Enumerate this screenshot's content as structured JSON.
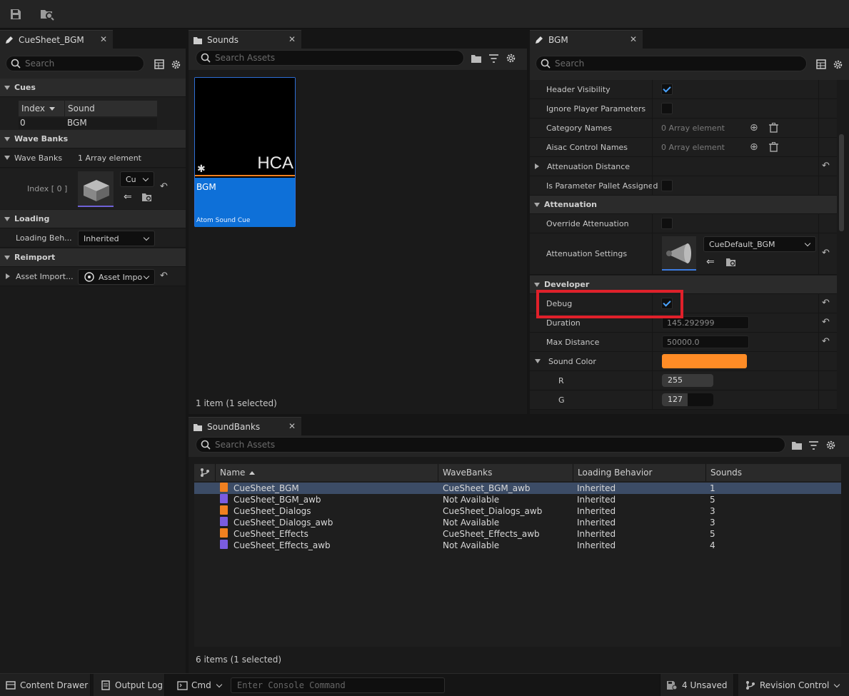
{
  "toolbar": {
    "save_icon": "save-icon",
    "browse_icon": "browse-to-asset-icon"
  },
  "left_panel": {
    "tab": "CueSheet_BGM",
    "search_placeholder": "Search",
    "sections": {
      "cues": "Cues",
      "wave_banks": "Wave Banks",
      "loading": "Loading",
      "reimport": "Reimport"
    },
    "cues_table": {
      "headers": [
        "Index",
        "Sound"
      ],
      "rows": [
        [
          "0",
          "BGM"
        ]
      ]
    },
    "wave_banks_row": {
      "label": "Wave Banks",
      "value": "1 Array element"
    },
    "index_row": {
      "label": "Index [ 0 ]",
      "combo": "Cu"
    },
    "loading_row": {
      "label": "Loading Beh...",
      "value": "Inherited"
    },
    "reimport_row": {
      "label": "Asset Import...",
      "value": "Asset Impo"
    }
  },
  "sounds_panel": {
    "tab": "Sounds",
    "search_placeholder": "Search Assets",
    "asset": {
      "thumb_text": "HCA",
      "name": "BGM",
      "type": "Atom Sound Cue"
    },
    "status": "1 item (1 selected)"
  },
  "details_panel": {
    "tab": "BGM",
    "search_placeholder": "Search",
    "rows": {
      "header_visibility": "Header Visibility",
      "ignore_player_params": "Ignore Player Parameters",
      "category_names": "Category Names",
      "category_value": "0 Array element",
      "aisac_names": "Aisac Control Names",
      "aisac_value": "0 Array element",
      "attenuation_distance": "Attenuation Distance",
      "param_pallet": "Is Parameter Pallet Assigned",
      "attenuation_section": "Attenuation",
      "override_attenuation": "Override Attenuation",
      "attenuation_settings": "Attenuation Settings",
      "attenuation_combo": "CueDefault_BGM",
      "developer_section": "Developer",
      "debug": "Debug",
      "duration": "Duration",
      "duration_value": "145.292999",
      "max_distance": "Max Distance",
      "max_distance_value": "50000.0",
      "sound_color": "Sound Color",
      "r": "R",
      "r_value": "255",
      "g": "G",
      "g_value": "127"
    },
    "colors": {
      "sound_color": "#ff8c26",
      "highlight": "#e0202a"
    },
    "checks": {
      "header_visibility": true,
      "debug": true
    }
  },
  "soundbanks_panel": {
    "tab": "SoundBanks",
    "search_placeholder": "Search Assets",
    "columns": [
      "Name",
      "WaveBanks",
      "Loading Behavior",
      "Sounds"
    ],
    "rows": [
      {
        "name": "CueSheet_BGM",
        "wavebanks": "CueSheet_BGM_awb",
        "loading": "Inherited",
        "sounds": "1",
        "color": "#f08020"
      },
      {
        "name": "CueSheet_BGM_awb",
        "wavebanks": "Not Available",
        "loading": "Inherited",
        "sounds": "5",
        "color": "#7a5ce0"
      },
      {
        "name": "CueSheet_Dialogs",
        "wavebanks": "CueSheet_Dialogs_awb",
        "loading": "Inherited",
        "sounds": "3",
        "color": "#f08020"
      },
      {
        "name": "CueSheet_Dialogs_awb",
        "wavebanks": "Not Available",
        "loading": "Inherited",
        "sounds": "3",
        "color": "#7a5ce0"
      },
      {
        "name": "CueSheet_Effects",
        "wavebanks": "CueSheet_Effects_awb",
        "loading": "Inherited",
        "sounds": "5",
        "color": "#f08020"
      },
      {
        "name": "CueSheet_Effects_awb",
        "wavebanks": "Not Available",
        "loading": "Inherited",
        "sounds": "4",
        "color": "#7a5ce0"
      }
    ],
    "status": "6 items (1 selected)"
  },
  "statusbar": {
    "content_drawer": "Content Drawer",
    "output_log": "Output Log",
    "cmd": "Cmd",
    "console_placeholder": "Enter Console Command",
    "unsaved": "4 Unsaved",
    "revision_control": "Revision Control"
  }
}
